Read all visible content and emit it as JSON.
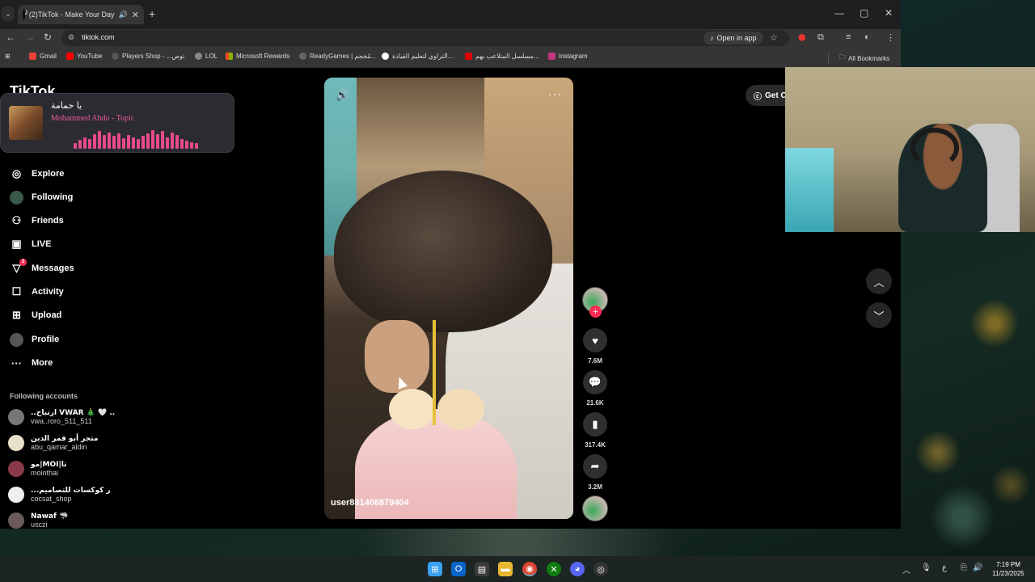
{
  "browser": {
    "tab_title": "(2)TikTok - Make Your Day",
    "tab_close": "✕",
    "new_tab": "+",
    "url": "tiktok.com",
    "open_in_app": "Open in app",
    "window_controls": [
      "—",
      "▢",
      "✕"
    ]
  },
  "bookmarks": [
    {
      "label": "Gmail",
      "color": "#ea4335"
    },
    {
      "label": "YouTube",
      "color": "#ff0000"
    },
    {
      "label": "Players Shop - ...توص",
      "color": "#555555"
    },
    {
      "label": "LOL",
      "color": "#888888"
    },
    {
      "label": "Microsoft Rewards",
      "color": "#f25022"
    },
    {
      "label": "ReadyGames | مُخجم...",
      "color": "#666666"
    },
    {
      "label": "التراوي لتعليم القيادة...",
      "color": "#111111"
    },
    {
      "label": "مسلسل المتلاعب بهم...",
      "color": "#d00000"
    },
    {
      "label": "Instagram",
      "color": "#c13584"
    }
  ],
  "all_bookmarks": "All Bookmarks",
  "tiktok": {
    "logo": "TikTok",
    "music_popup": {
      "title": "يا حمامة",
      "artist": "Mohammed Abdo - Topic",
      "eq_levels": [
        0.3,
        0.45,
        0.6,
        0.5,
        0.75,
        0.9,
        0.7,
        0.85,
        0.65,
        0.8,
        0.55,
        0.7,
        0.6,
        0.5,
        0.65,
        0.8,
        0.95,
        0.75,
        0.9,
        0.6,
        0.85,
        0.7,
        0.5,
        0.4,
        0.35,
        0.3
      ]
    },
    "nav": [
      {
        "label": "Explore",
        "icon": "◎"
      },
      {
        "label": "Following",
        "icon": "●"
      },
      {
        "label": "Friends",
        "icon": "⚇"
      },
      {
        "label": "LIVE",
        "icon": "▣"
      },
      {
        "label": "Messages",
        "icon": "▽",
        "badge": "2"
      },
      {
        "label": "Activity",
        "icon": "☐"
      },
      {
        "label": "Upload",
        "icon": "⊞"
      },
      {
        "label": "Profile",
        "icon": "●"
      },
      {
        "label": "More",
        "icon": "···"
      }
    ],
    "following_heading": "Following accounts",
    "accounts": [
      {
        "name": "..ارتباح VWAR 🎄 🤍 ..",
        "handle": "vwa..roro_511_511"
      },
      {
        "name": "متجر أبو قمر الدين",
        "handle": "abu_qamar_aldin"
      },
      {
        "name": "مو|MOI|تا",
        "handle": "mointhai"
      },
      {
        "name": "...ر كوكسات للتصاميم",
        "handle": "cocsat_shop"
      },
      {
        "name": "Nawaf 🦈",
        "handle": "usczi"
      }
    ],
    "video": {
      "username": "user881408879404",
      "sound_icon": "🔊",
      "more_icon": "···"
    },
    "actions": {
      "likes": "7.6M",
      "comments": "21.6K",
      "saves": "317.4K",
      "shares": "3.2M"
    },
    "get_coins": "Get C"
  },
  "taskbar": {
    "time": "7:19 PM",
    "date": "11/23/2025",
    "lang": "ع"
  }
}
